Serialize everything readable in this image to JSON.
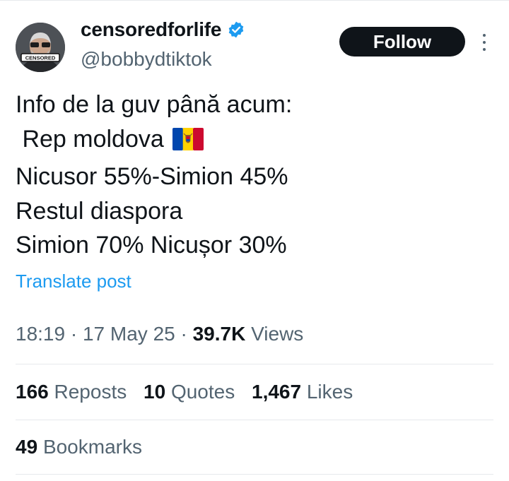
{
  "author": {
    "display_name": "censoredforlife",
    "handle": "@bobbydtiktok",
    "verified_icon": "verified-badge-icon",
    "avatar_text": "CENSORED"
  },
  "follow_button": {
    "label": "Follow"
  },
  "more_button": {
    "icon": "more-vertical-icon"
  },
  "post": {
    "lines": [
      "Info de la guv până acum:",
      " Rep moldova",
      "Nicusor 55%-Simion 45%",
      "Restul diaspora",
      "Simion 70% Nicușor 30%"
    ],
    "flag_icon": "moldova-flag-icon"
  },
  "translate_link": "Translate post",
  "meta": {
    "time": "18:19",
    "date": "17 May 25",
    "views_count": "39.7K",
    "views_label": "Views"
  },
  "stats": {
    "reposts": {
      "count": "166",
      "label": "Reposts"
    },
    "quotes": {
      "count": "10",
      "label": "Quotes"
    },
    "likes": {
      "count": "1,467",
      "label": "Likes"
    }
  },
  "bookmarks": {
    "count": "49",
    "label": "Bookmarks"
  },
  "colors": {
    "text": "#0f1419",
    "secondary": "#536471",
    "link": "#1d9bf0",
    "verified": "#1d9bf0",
    "follow_bg": "#0f1419",
    "divider": "#e6e9ec"
  }
}
